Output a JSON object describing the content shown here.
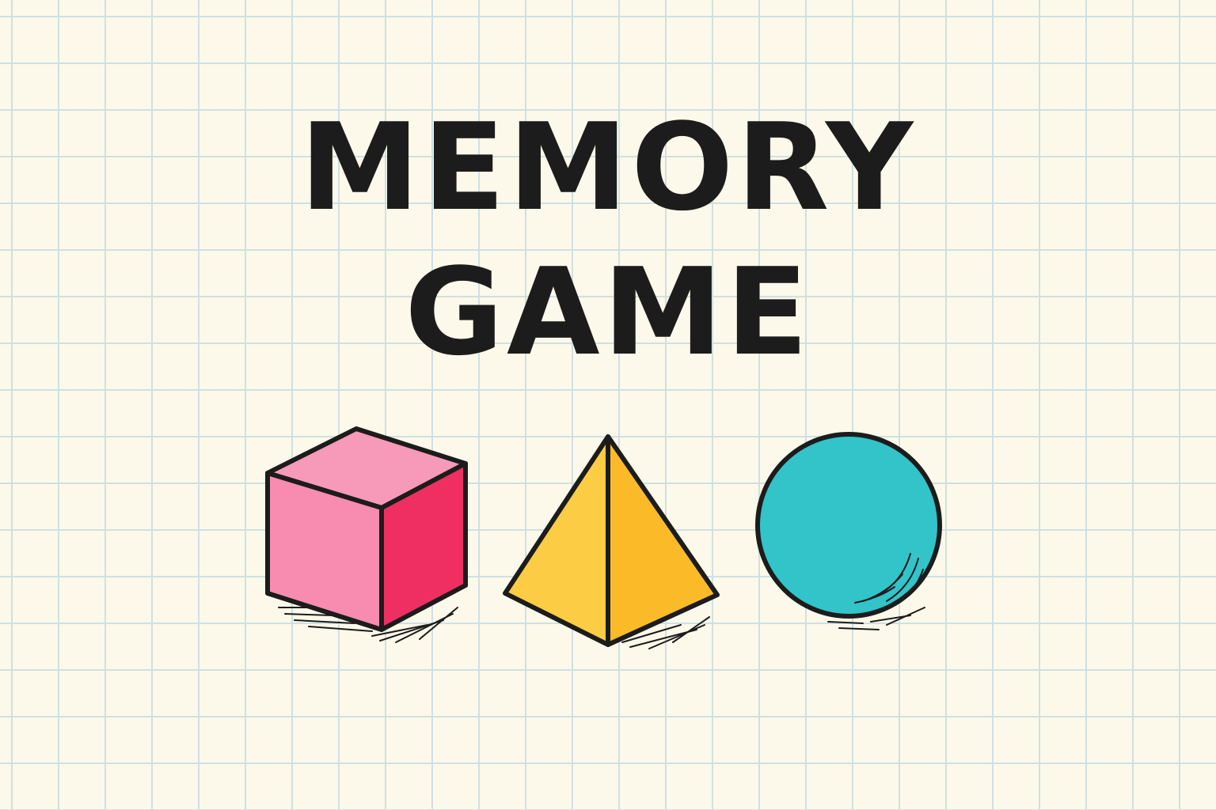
{
  "game": {
    "title_line_1": "MEMORY",
    "title_line_2": "GAME"
  },
  "shapes": [
    {
      "id": "cube",
      "icon": "cube-icon",
      "color_front": "#f78bb0",
      "color_top": "#f79ab9",
      "color_side": "#ef2f62"
    },
    {
      "id": "pyramid",
      "icon": "pyramid-icon",
      "color_left": "#fccc44",
      "color_right": "#fbbb28"
    },
    {
      "id": "sphere",
      "icon": "sphere-icon",
      "color": "#32c4c9"
    }
  ],
  "colors": {
    "background": "#fcf9ea",
    "grid": "#cfe0e3",
    "ink": "#1c1c1c"
  }
}
